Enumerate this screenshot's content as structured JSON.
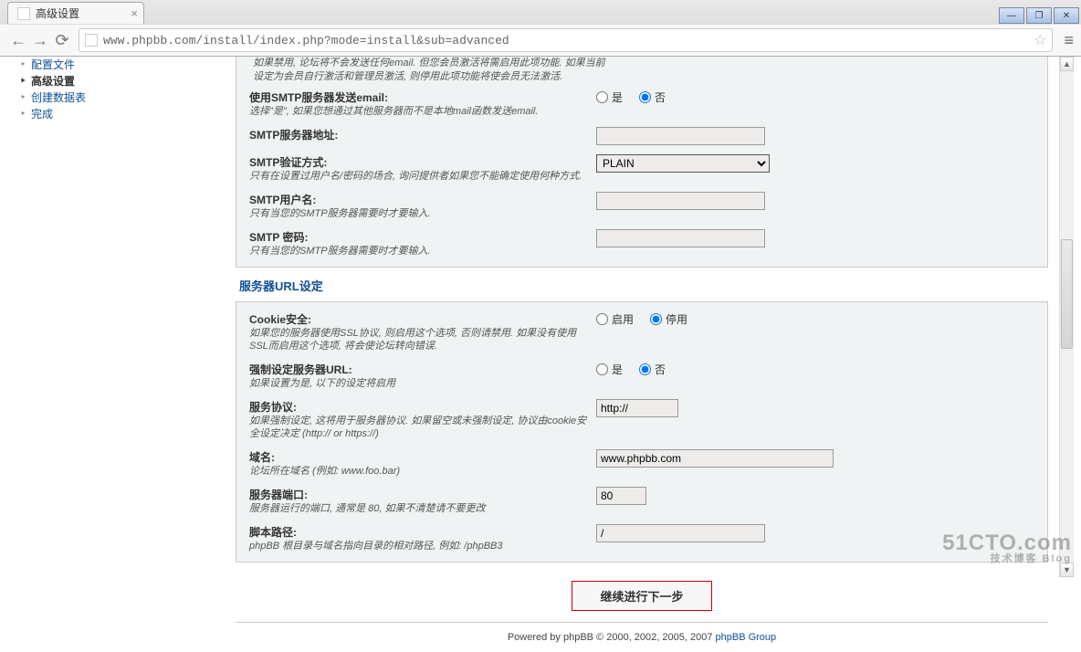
{
  "browser": {
    "tab_title": "高级设置",
    "url": "www.phpbb.com/install/index.php?mode=install&sub=advanced"
  },
  "sidebar": {
    "items": [
      {
        "label": "配置文件"
      },
      {
        "label": "高级设置"
      },
      {
        "label": "创建数据表"
      },
      {
        "label": "完成"
      }
    ]
  },
  "top_note": {
    "line1": "如果禁用, 论坛将不会发送任何email. 但您会员激活将需启用此项功能. 如果当前",
    "line2": "设定为会员自行激活和管理员激活, 则停用此项功能将使会员无法激活."
  },
  "email": {
    "smtp_send": {
      "label": "使用SMTP服务器发送email:",
      "desc": "选择\"是\", 如果您想通过其他服务器而不是本地mail函数发送email.",
      "yes": "是",
      "no": "否"
    },
    "smtp_server": {
      "label": "SMTP服务器地址:",
      "value": ""
    },
    "smtp_auth": {
      "label": "SMTP验证方式:",
      "desc": "只有在设置过用户名/密码的场合, 询问提供者如果您不能确定使用何种方式.",
      "value": "PLAIN"
    },
    "smtp_user": {
      "label": "SMTP用户名:",
      "desc": "只有当您的SMTP服务器需要时才要输入.",
      "value": ""
    },
    "smtp_pass": {
      "label": "SMTP 密码:",
      "desc": "只有当您的SMTP服务器需要时才要输入.",
      "value": ""
    }
  },
  "url": {
    "section": "服务器URL设定",
    "cookie": {
      "label": "Cookie安全:",
      "desc": "如果您的服务器使用SSL协议, 则启用这个选项, 否则请禁用. 如果没有使用SSL而启用这个选项, 将会使论坛转向错误.",
      "on": "启用",
      "off": "停用"
    },
    "force": {
      "label": "强制设定服务器URL:",
      "desc": "如果设置为是, 以下的设定将启用",
      "yes": "是",
      "no": "否"
    },
    "protocol": {
      "label": "服务协议:",
      "desc": "如果强制设定, 这将用于服务器协议. 如果留空或未强制设定, 协议由cookie安全设定决定 (http:// or https://)",
      "value": "http://"
    },
    "domain": {
      "label": "域名:",
      "desc": "论坛所在域名 (例如: www.foo.bar)",
      "value": "www.phpbb.com"
    },
    "port": {
      "label": "服务器端口:",
      "desc": "服务器运行的端口, 通常是 80, 如果不清楚请不要更改",
      "value": "80"
    },
    "script": {
      "label": "脚本路径:",
      "desc": "phpBB 根目录与域名指向目录的相对路径, 例如: /phpBB3",
      "value": "/"
    }
  },
  "submit": {
    "label": "继续进行下一步"
  },
  "footer": {
    "prefix": "Powered by phpBB © 2000, 2002, 2005, 2007 ",
    "link": "phpBB Group"
  },
  "watermark": {
    "big": "51CTO.com",
    "small": "技术博客   Blog"
  }
}
